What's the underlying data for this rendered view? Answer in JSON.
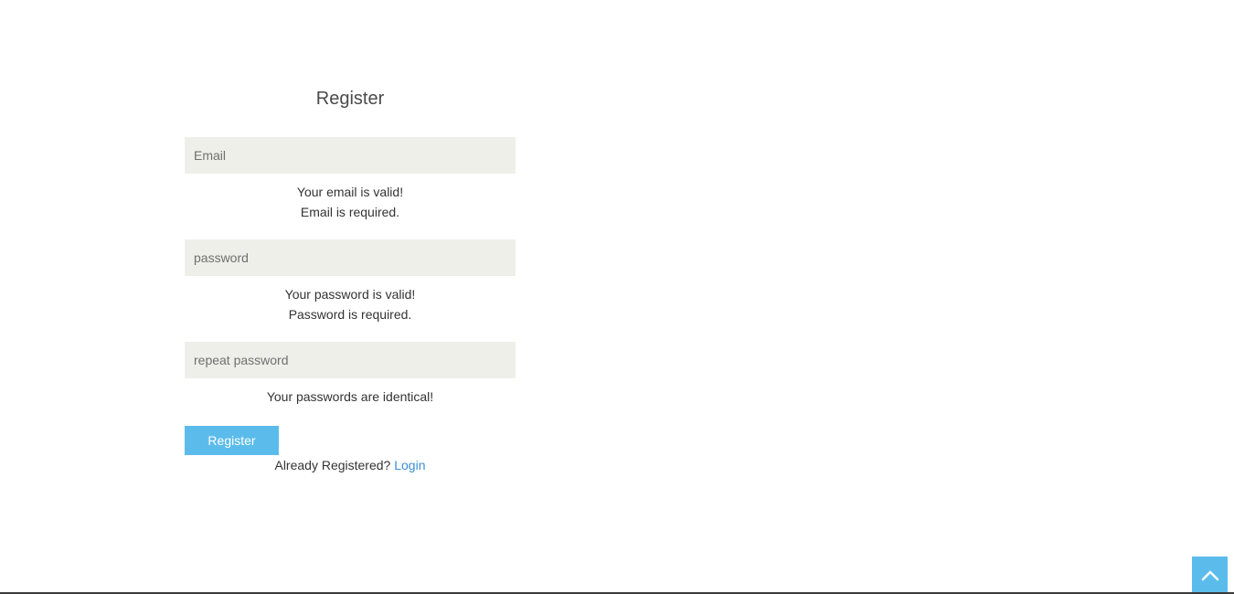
{
  "form": {
    "title": "Register",
    "email": {
      "placeholder": "Email",
      "value": "",
      "messages": [
        "Your email is valid!",
        "Email is required."
      ]
    },
    "password": {
      "placeholder": "password",
      "value": "",
      "messages": [
        "Your password is valid!",
        "Password is required."
      ]
    },
    "repeat_password": {
      "placeholder": "repeat password",
      "value": "",
      "messages": [
        "Your passwords are identical!"
      ]
    },
    "register_button_label": "Register",
    "login_prompt": "Already Registered?",
    "login_link_label": "Login"
  },
  "scroll_top": {
    "icon": "chevron-up-icon"
  },
  "colors": {
    "accent": "#5bbcec",
    "link": "#3b8fd4",
    "field_bg": "#efefe9"
  }
}
